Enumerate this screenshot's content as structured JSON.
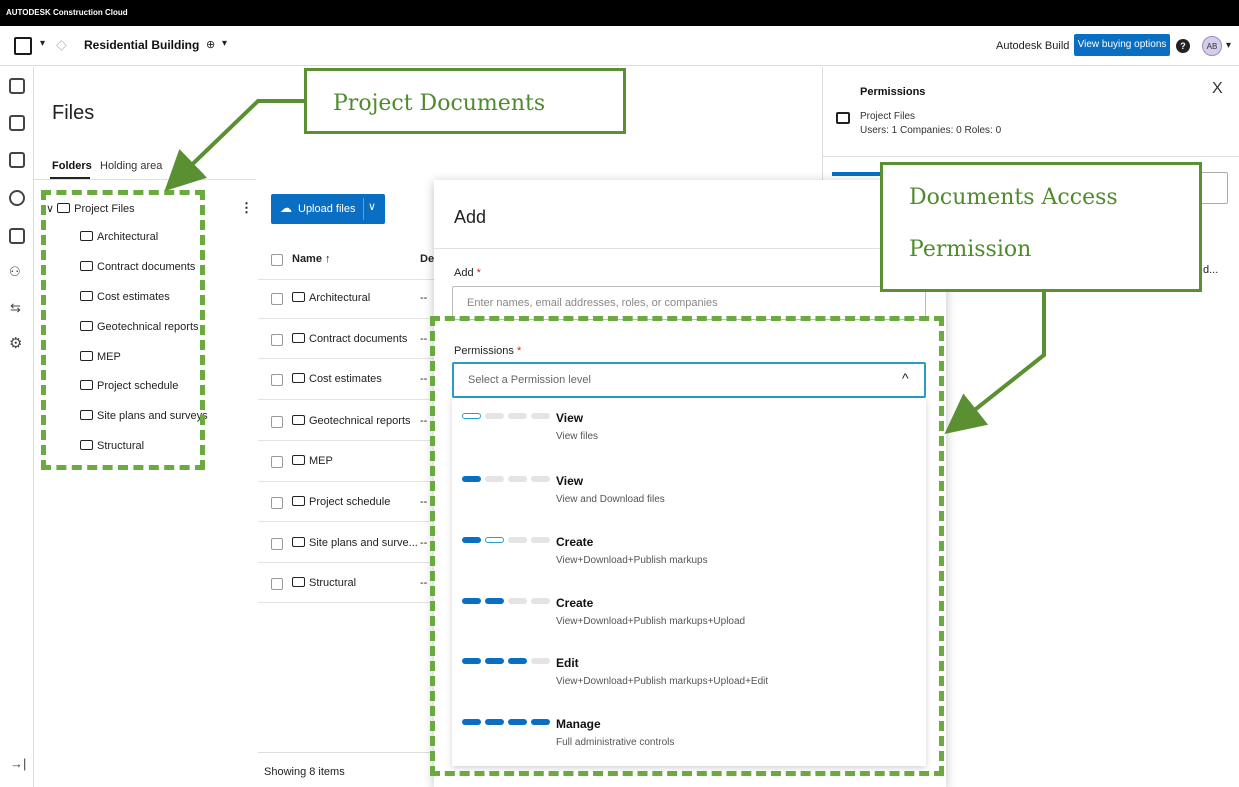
{
  "topbar": {
    "brand": "AUTODESK Construction Cloud"
  },
  "header": {
    "project_name": "Residential Building",
    "build_label": "Autodesk Build",
    "buy_button": "View buying options",
    "avatar_initials": "AB"
  },
  "files": {
    "title": "Files",
    "tabs": [
      "Folders",
      "Holding area"
    ]
  },
  "tree": {
    "root": "Project Files",
    "children": [
      "Architectural",
      "Contract documents",
      "Cost estimates",
      "Geotechnical reports",
      "MEP",
      "Project schedule",
      "Site plans and surveys",
      "Structural"
    ]
  },
  "list": {
    "upload_label": "Upload files",
    "col_name": "Name",
    "col_partial": "De",
    "rows": [
      "Architectural",
      "Contract documents",
      "Cost estimates",
      "Geotechnical reports",
      "MEP",
      "Project schedule",
      "Site plans and surve...",
      "Structural"
    ],
    "row_dash": "--",
    "footer": "Showing 8 items"
  },
  "permissions_panel": {
    "title": "Permissions",
    "close": "X",
    "folder_name": "Project Files",
    "counts": "Users: 1  Companies: 0  Roles: 0",
    "truncated": "d..."
  },
  "modal": {
    "title": "Add",
    "add_label": "Add",
    "required_mark": "*",
    "add_placeholder": "Enter names, email addresses, roles, or companies",
    "permissions_label": "Permissions",
    "select_placeholder": "Select a Permission level",
    "options": [
      {
        "title": "View",
        "desc": "View files"
      },
      {
        "title": "View",
        "desc": "View and Download files"
      },
      {
        "title": "Create",
        "desc": "View+Download+Publish markups"
      },
      {
        "title": "Create",
        "desc": "View+Download+Publish markups+Upload"
      },
      {
        "title": "Edit",
        "desc": "View+Download+Publish markups+Upload+Edit"
      },
      {
        "title": "Manage",
        "desc": "Full administrative controls"
      }
    ]
  },
  "annotations": {
    "project_documents": "Project Documents",
    "access_line1": "Documents Access",
    "access_line2": "Permission"
  },
  "colors": {
    "accent": "#0a6fc2",
    "annotation_green": "#6aaa3f",
    "focus": "#2a9dc4"
  }
}
